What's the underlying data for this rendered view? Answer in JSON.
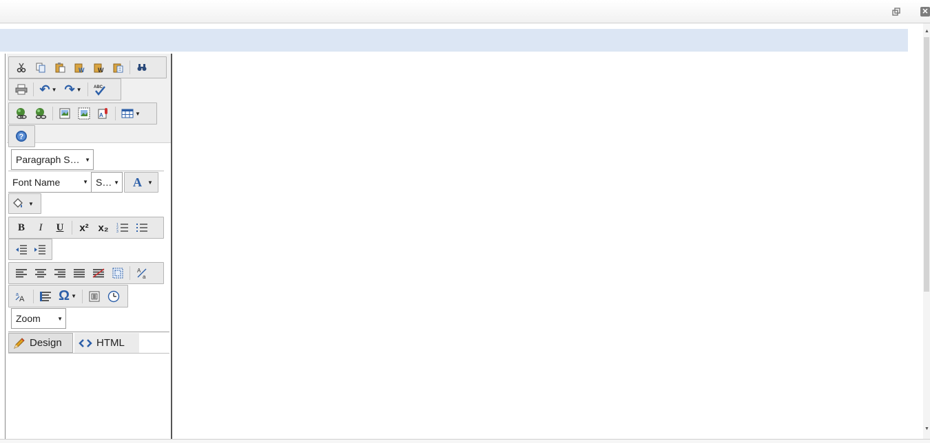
{
  "window": {
    "restore_icon": "restore-window-icon",
    "close_icon": "close-window-icon",
    "close_label": "✕"
  },
  "toolbar": {
    "row1": [
      "cut-icon",
      "copy-icon",
      "paste-icon",
      "paste-from-word-icon",
      "paste-plain-text-icon",
      "paste-as-html-icon",
      "find-replace-icon"
    ],
    "row2": [
      "print-icon",
      "undo-icon",
      "redo-icon",
      "spell-check-icon"
    ],
    "row3": [
      "insert-link-icon",
      "remove-link-icon",
      "image-manager-icon",
      "image-map-icon",
      "document-manager-icon",
      "insert-table-icon"
    ],
    "row4": [
      "help-icon"
    ],
    "paragraph_style": "Paragraph S…",
    "font_name": "Font Name",
    "font_size": "S…",
    "font_color_glyph": "A",
    "format_row": {
      "bold": "B",
      "italic": "I",
      "underline": "U",
      "superscript": "x²",
      "subscript": "x₂"
    },
    "special_char_glyph": "Ω",
    "zoom_label": "Zoom"
  },
  "modes": {
    "design_label": "Design",
    "html_label": "HTML"
  }
}
